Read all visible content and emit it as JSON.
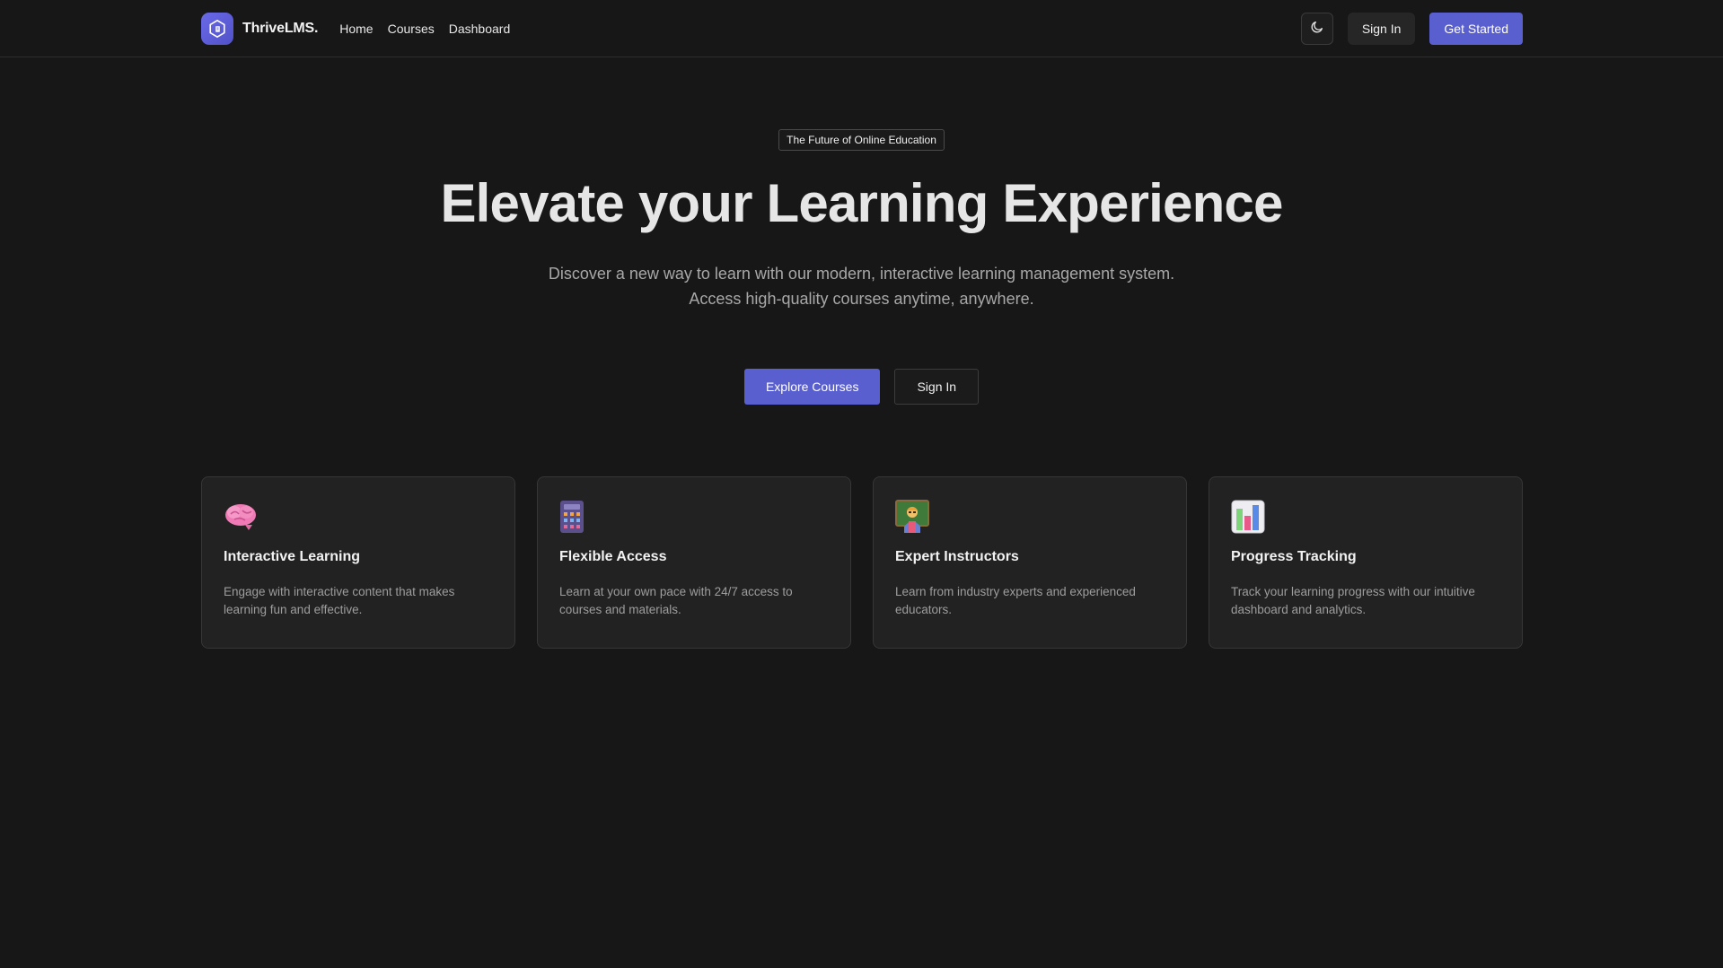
{
  "brand": {
    "name": "ThriveLMS.",
    "logo_icon": "book-hexagon-icon",
    "accent": "#5a5fcf"
  },
  "nav": {
    "links": [
      {
        "label": "Home"
      },
      {
        "label": "Courses"
      },
      {
        "label": "Dashboard"
      }
    ],
    "theme_icon": "moon-icon",
    "signin_label": "Sign In",
    "getstarted_label": "Get Started"
  },
  "hero": {
    "badge": "The Future of Online Education",
    "title": "Elevate your Learning Experience",
    "subtitle_line1": "Discover a new way to learn with our modern, interactive learning management system.",
    "subtitle_line2": "Access high-quality courses anytime, anywhere.",
    "primary_label": "Explore Courses",
    "secondary_label": "Sign In"
  },
  "features": [
    {
      "icon": "brain-icon",
      "title": "Interactive Learning",
      "text": "Engage with interactive content that makes learning fun and effective."
    },
    {
      "icon": "calculator-icon",
      "title": "Flexible Access",
      "text": "Learn at your own pace with 24/7 access to courses and materials."
    },
    {
      "icon": "teacher-icon",
      "title": "Expert Instructors",
      "text": "Learn from industry experts and experienced educators."
    },
    {
      "icon": "bar-chart-icon",
      "title": "Progress Tracking",
      "text": "Track your learning progress with our intuitive dashboard and analytics."
    }
  ]
}
